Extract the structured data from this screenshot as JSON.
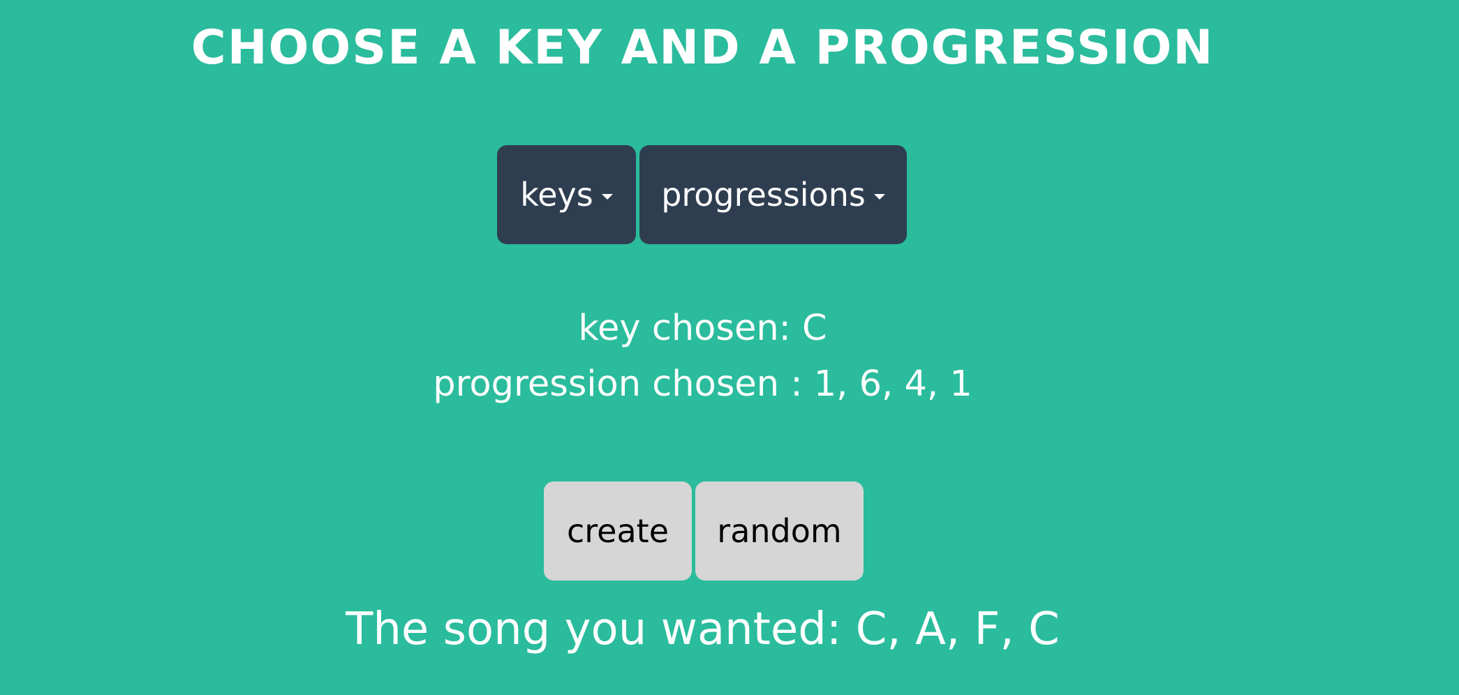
{
  "header": {
    "title": "CHOOSE A KEY AND A PROGRESSION"
  },
  "dropdowns": {
    "keys_label": "keys",
    "progressions_label": "progressions"
  },
  "selection": {
    "key_text": "key chosen: C",
    "progression_text": "progression chosen : 1, 6, 4, 1"
  },
  "actions": {
    "create_label": "create",
    "random_label": "random"
  },
  "result": {
    "song_text": "The song you wanted: C, A, F, C"
  },
  "colors": {
    "background": "#2abc9c",
    "dropdown_bg": "#2e3e50",
    "action_bg": "#d6d6d6",
    "text": "#ffffff"
  },
  "icons": {
    "dropdown_caret": "caret-down-icon"
  }
}
